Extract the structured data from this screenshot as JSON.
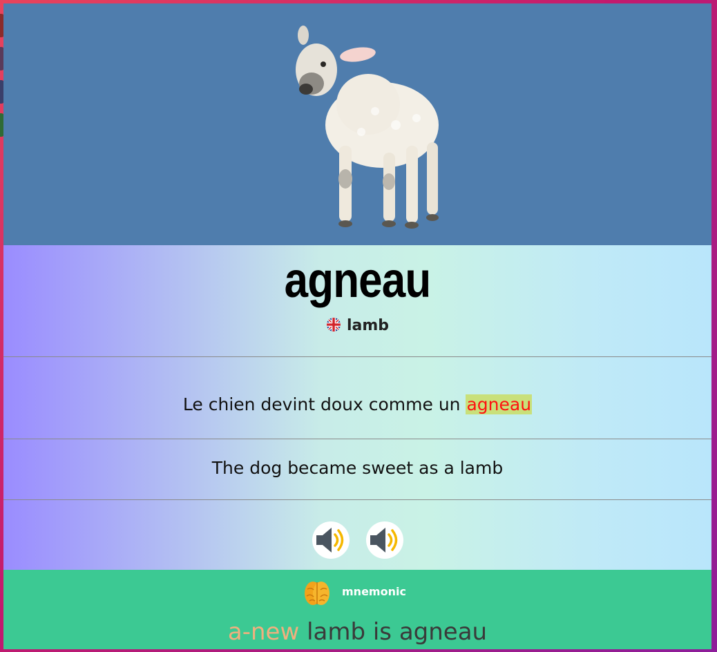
{
  "card": {
    "word": "agneau",
    "translation": "lamb",
    "example_fr_prefix": "Le chien devint doux comme un ",
    "example_fr_highlight": "agneau",
    "example_en": "The dog became sweet as a lamb"
  },
  "audio": [
    {
      "icon": "speaker-icon"
    },
    {
      "icon": "speaker-icon"
    }
  ],
  "mnemonic": {
    "label": "mnemonic",
    "icon": "brain-icon",
    "accent": "a-new",
    "rest": " lamb is agneau"
  },
  "colors": {
    "image_bg": "#4f7dad",
    "mnemonic_bg": "#3cc993",
    "highlight_bg": "#c9e07a",
    "highlight_text": "#ff1010",
    "mnemonic_accent": "#f0b07e"
  }
}
